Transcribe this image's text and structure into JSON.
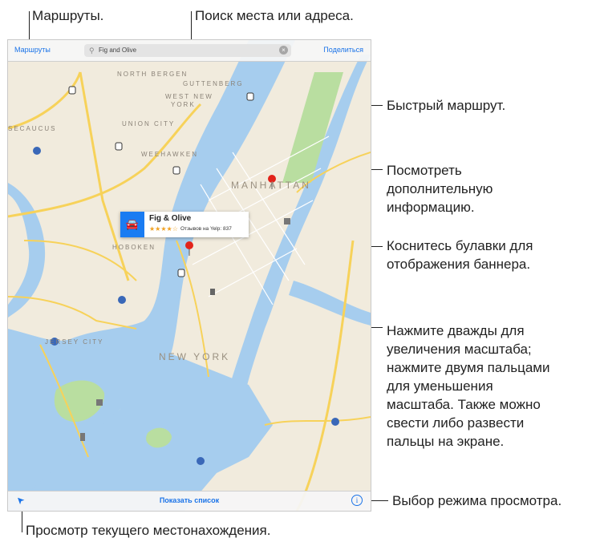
{
  "callouts": {
    "routes": "Маршруты.",
    "search": "Поиск места или адреса.",
    "quick_route": "Быстрый маршрут.",
    "more_info": [
      "Посмотреть",
      "дополнительную",
      "информацию."
    ],
    "tap_pin": [
      "Коснитесь булавки для",
      "отображения баннера."
    ],
    "zoom": [
      "Нажмите дважды для",
      "увеличения масштаба;",
      "нажмите двумя пальцами",
      "для уменьшения",
      "масштаба. Также можно",
      "свести либо развести",
      "пальцы на экране."
    ],
    "view_mode": "Выбор режима просмотра.",
    "current_location": "Просмотр текущего местонахождения."
  },
  "topbar": {
    "routes_label": "Маршруты",
    "search_value": "Fig and Olive",
    "share_label": "Поделиться"
  },
  "banner": {
    "name": "Fig & Olive",
    "stars": "★★★★☆",
    "reviews": "Отзывов на Yelp: 837"
  },
  "bottombar": {
    "show_list_label": "Показать список",
    "info_glyph": "i",
    "location_glyph": "➤"
  },
  "map_labels": {
    "north_bergen": "NORTH BERGEN",
    "guttenberg": "GUTTENBERG",
    "west_new_york": [
      "WEST NEW",
      "YORK"
    ],
    "union_city": "UNION CITY",
    "secaucus": "SECAUCUS",
    "weehawken": "WEEHAWKEN",
    "manhattan": "MANHATTAN",
    "hoboken": "HOBOKEN",
    "jersey_city": "JERSEY CITY",
    "new_york": "NEW YORK"
  },
  "colors": {
    "accent": "#1a7cf2",
    "water": "#a6cdee",
    "land": "#f1ebdd",
    "park": "#b9dea0",
    "highway": "#f7d25a",
    "pin": "#e2231a"
  },
  "icons": {
    "search": "search-icon",
    "clear": "clear-icon",
    "car": "car-icon",
    "pin": "map-pin-icon",
    "location": "location-arrow-icon",
    "info": "info-icon"
  }
}
